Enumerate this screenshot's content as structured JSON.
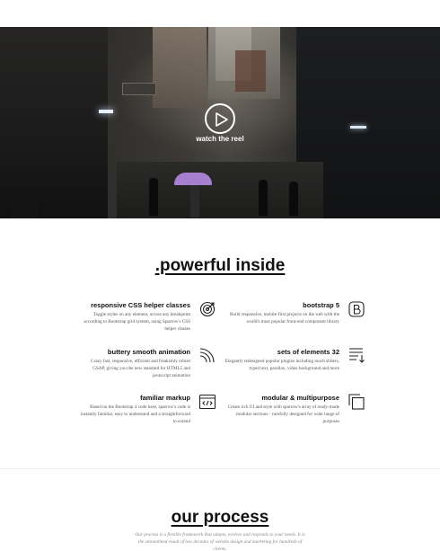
{
  "hero": {
    "reel_label": "watch the reel"
  },
  "powerful": {
    "title": ".powerful inside",
    "features": [
      {
        "title": "responsive CSS helper classes",
        "desc": "Toggle styles on any element, across any breakpoint according to Bootstrap grid system, using Sparrow's CSS helper classes",
        "icon": "target-icon"
      },
      {
        "title": "bootstrap 5",
        "desc": "Build responsive, mobile-first projects on the web with the world's most popular front-end component library",
        "icon": "bootstrap-icon"
      },
      {
        "title": "buttery smooth animation",
        "desc": "Crazy fast, responsive, efficient and freakishly robust GSAP, giving you the new standard for HTML5 and javascript animation",
        "icon": "waves-icon"
      },
      {
        "title": "sets of elements 32",
        "desc": "Elegantly redesigned popular plugins including touch sliders, typed text, parallax, video background and more",
        "icon": "list-arrow-icon"
      },
      {
        "title": "familiar markup",
        "desc": "Based on the Bootstrap 4 code base, sparrow's code is instantly familiar, easy to understand and a straightforward to extend",
        "icon": "code-icon"
      },
      {
        "title": "modular & multipurpose",
        "desc": "Create rich UI and style with sparrow's array of ready-made modular sections - carefully designed for wide range of purposes",
        "icon": "copy-icon"
      }
    ]
  },
  "process": {
    "title": "our process",
    "desc": "Our process is a flexible framework that adapts, evolves and responds to your needs. It is the streamlined result of two decades of website design and marketing for hundreds of clients."
  },
  "colors": {
    "text": "#111111",
    "muted": "#555555",
    "hero_umbrella": "#a67fcf"
  }
}
